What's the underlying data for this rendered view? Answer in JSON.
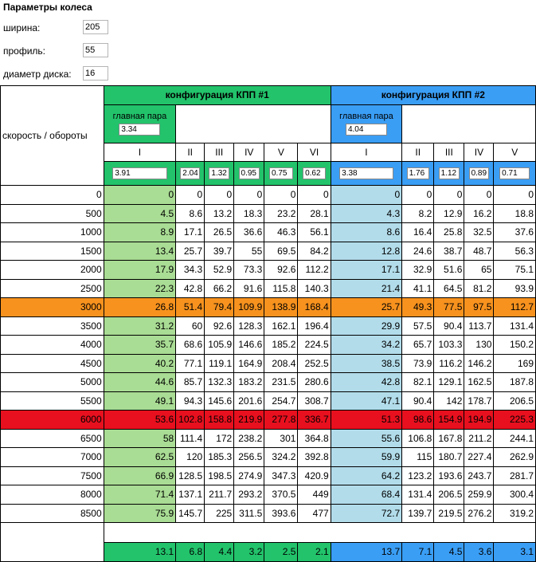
{
  "title": "Параметры колеса",
  "params": [
    {
      "label": "ширина:",
      "value": "205"
    },
    {
      "label": "профиль:",
      "value": "55"
    },
    {
      "label": "диаметр диска:",
      "value": "16"
    }
  ],
  "table": {
    "corner_label": "скорость / обороты",
    "main_pair_label": "главная пара",
    "configs": [
      {
        "title": "конфигурация КПП #1",
        "main_pair": "3.34",
        "gears": [
          "I",
          "II",
          "III",
          "IV",
          "V",
          "VI"
        ],
        "ratios": [
          "3.91",
          "2.04",
          "1.32",
          "0.95",
          "0.75",
          "0.62"
        ],
        "totals": [
          "13.1",
          "6.8",
          "4.4",
          "3.2",
          "2.5",
          "2.1"
        ]
      },
      {
        "title": "конфигурация КПП #2",
        "main_pair": "4.04",
        "gears": [
          "I",
          "II",
          "III",
          "IV",
          "V"
        ],
        "ratios": [
          "3.38",
          "1.76",
          "1.12",
          "0.89",
          "0.71"
        ],
        "totals": [
          "13.7",
          "7.1",
          "4.5",
          "3.6",
          "3.1"
        ]
      }
    ],
    "rows": [
      {
        "rpm": "0",
        "c1": [
          "0",
          "0",
          "0",
          "0",
          "0",
          "0"
        ],
        "c2": [
          "0",
          "0",
          "0",
          "0",
          "0"
        ]
      },
      {
        "rpm": "500",
        "c1": [
          "4.5",
          "8.6",
          "13.2",
          "18.3",
          "23.2",
          "28.1"
        ],
        "c2": [
          "4.3",
          "8.2",
          "12.9",
          "16.2",
          "18.8"
        ]
      },
      {
        "rpm": "1000",
        "c1": [
          "8.9",
          "17.1",
          "26.5",
          "36.6",
          "46.3",
          "56.1"
        ],
        "c2": [
          "8.6",
          "16.4",
          "25.8",
          "32.5",
          "37.6"
        ]
      },
      {
        "rpm": "1500",
        "c1": [
          "13.4",
          "25.7",
          "39.7",
          "55",
          "69.5",
          "84.2"
        ],
        "c2": [
          "12.8",
          "24.6",
          "38.7",
          "48.7",
          "56.3"
        ]
      },
      {
        "rpm": "2000",
        "c1": [
          "17.9",
          "34.3",
          "52.9",
          "73.3",
          "92.6",
          "112.2"
        ],
        "c2": [
          "17.1",
          "32.9",
          "51.6",
          "65",
          "75.1"
        ]
      },
      {
        "rpm": "2500",
        "c1": [
          "22.3",
          "42.8",
          "66.2",
          "91.6",
          "115.8",
          "140.3"
        ],
        "c2": [
          "21.4",
          "41.1",
          "64.5",
          "81.2",
          "93.9"
        ]
      },
      {
        "rpm": "3000",
        "c1": [
          "26.8",
          "51.4",
          "79.4",
          "109.9",
          "138.9",
          "168.4"
        ],
        "c2": [
          "25.7",
          "49.3",
          "77.5",
          "97.5",
          "112.7"
        ],
        "highlight": "orange"
      },
      {
        "rpm": "3500",
        "c1": [
          "31.2",
          "60",
          "92.6",
          "128.3",
          "162.1",
          "196.4"
        ],
        "c2": [
          "29.9",
          "57.5",
          "90.4",
          "113.7",
          "131.4"
        ]
      },
      {
        "rpm": "4000",
        "c1": [
          "35.7",
          "68.6",
          "105.9",
          "146.6",
          "185.2",
          "224.5"
        ],
        "c2": [
          "34.2",
          "65.7",
          "103.3",
          "130",
          "150.2"
        ]
      },
      {
        "rpm": "4500",
        "c1": [
          "40.2",
          "77.1",
          "119.1",
          "164.9",
          "208.4",
          "252.5"
        ],
        "c2": [
          "38.5",
          "73.9",
          "116.2",
          "146.2",
          "169"
        ]
      },
      {
        "rpm": "5000",
        "c1": [
          "44.6",
          "85.7",
          "132.3",
          "183.2",
          "231.5",
          "280.6"
        ],
        "c2": [
          "42.8",
          "82.1",
          "129.1",
          "162.5",
          "187.8"
        ]
      },
      {
        "rpm": "5500",
        "c1": [
          "49.1",
          "94.3",
          "145.6",
          "201.6",
          "254.7",
          "308.7"
        ],
        "c2": [
          "47.1",
          "90.4",
          "142",
          "178.7",
          "206.5"
        ]
      },
      {
        "rpm": "6000",
        "c1": [
          "53.6",
          "102.8",
          "158.8",
          "219.9",
          "277.8",
          "336.7"
        ],
        "c2": [
          "51.3",
          "98.6",
          "154.9",
          "194.9",
          "225.3"
        ],
        "highlight": "red"
      },
      {
        "rpm": "6500",
        "c1": [
          "58",
          "111.4",
          "172",
          "238.2",
          "301",
          "364.8"
        ],
        "c2": [
          "55.6",
          "106.8",
          "167.8",
          "211.2",
          "244.1"
        ]
      },
      {
        "rpm": "7000",
        "c1": [
          "62.5",
          "120",
          "185.3",
          "256.5",
          "324.2",
          "392.8"
        ],
        "c2": [
          "59.9",
          "115",
          "180.7",
          "227.4",
          "262.9"
        ]
      },
      {
        "rpm": "7500",
        "c1": [
          "66.9",
          "128.5",
          "198.5",
          "274.9",
          "347.3",
          "420.9"
        ],
        "c2": [
          "64.2",
          "123.2",
          "193.6",
          "243.7",
          "281.7"
        ]
      },
      {
        "rpm": "8000",
        "c1": [
          "71.4",
          "137.1",
          "211.7",
          "293.2",
          "370.5",
          "449"
        ],
        "c2": [
          "68.4",
          "131.4",
          "206.5",
          "259.9",
          "300.4"
        ]
      },
      {
        "rpm": "8500",
        "c1": [
          "75.9",
          "145.7",
          "225",
          "311.5",
          "393.6",
          "477"
        ],
        "c2": [
          "72.7",
          "139.7",
          "219.5",
          "276.2",
          "319.2"
        ]
      }
    ]
  }
}
